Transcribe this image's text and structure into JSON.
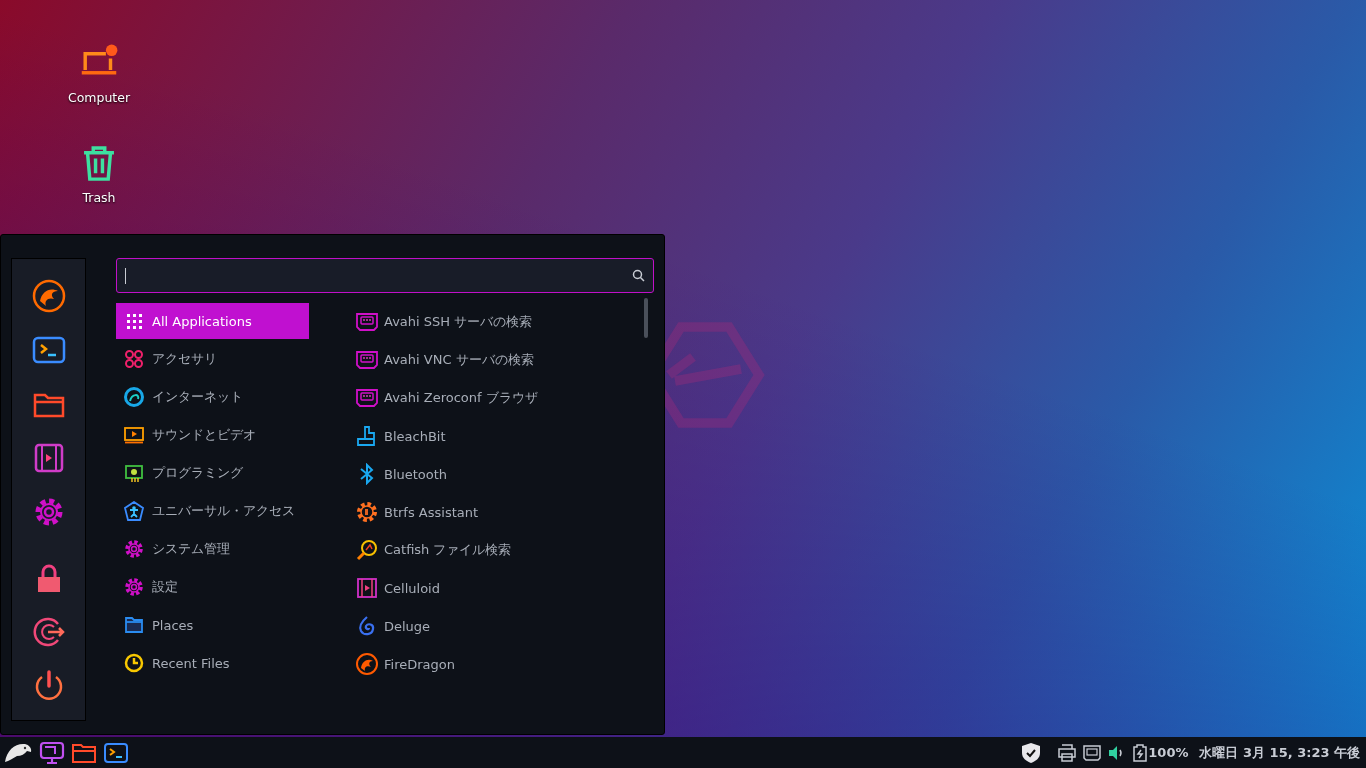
{
  "desktop": {
    "icons": [
      {
        "label": "Computer"
      },
      {
        "label": "Trash"
      }
    ]
  },
  "menu": {
    "categories": [
      {
        "label": "All Applications",
        "selected": true
      },
      {
        "label": "アクセサリ",
        "selected": false
      },
      {
        "label": "インターネット",
        "selected": false
      },
      {
        "label": "サウンドとビデオ",
        "selected": false
      },
      {
        "label": "プログラミング",
        "selected": false
      },
      {
        "label": "ユニバーサル・アクセス",
        "selected": false
      },
      {
        "label": "システム管理",
        "selected": false
      },
      {
        "label": "設定",
        "selected": false
      },
      {
        "label": "Places",
        "selected": false
      },
      {
        "label": "Recent Files",
        "selected": false
      }
    ],
    "apps": [
      {
        "label": "Avahi SSH サーバの検索"
      },
      {
        "label": "Avahi VNC サーバの検索"
      },
      {
        "label": "Avahi Zeroconf ブラウザ"
      },
      {
        "label": "BleachBit"
      },
      {
        "label": "Bluetooth"
      },
      {
        "label": "Btrfs Assistant"
      },
      {
        "label": "Catfish ファイル検索"
      },
      {
        "label": "Celluloid"
      },
      {
        "label": "Deluge"
      },
      {
        "label": "FireDragon"
      }
    ]
  },
  "taskbar": {
    "battery": "100%",
    "clock": "水曜日 3月 15,  3:23 午後"
  }
}
